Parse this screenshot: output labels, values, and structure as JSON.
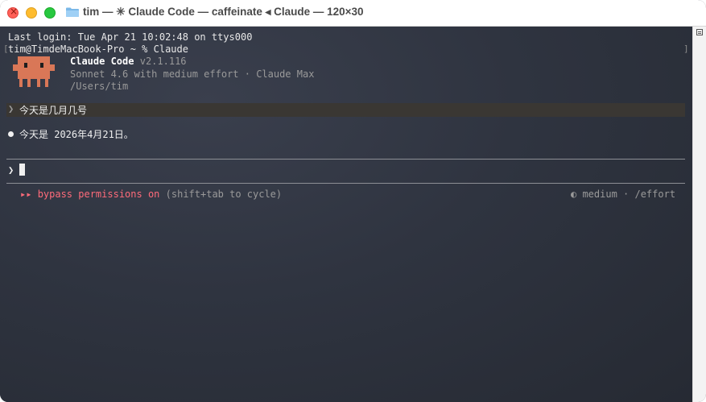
{
  "window": {
    "title": "tim — ✳ Claude Code — caffeinate ◂ Claude — 120×30"
  },
  "terminal": {
    "last_login": "Last login: Tue Apr 21 10:02:48 on ttys000",
    "shell_prompt": "tim@TimdeMacBook-Pro ~ % Claude",
    "bracket_left": "[",
    "bracket_right": "]",
    "banner": {
      "name": "Claude Code",
      "version": "v2.1.116",
      "model": "Sonnet 4.6 with medium effort · Claude Max",
      "path": "/Users/tim"
    },
    "user_message": {
      "chevron": "❯",
      "text": "今天是几月几号"
    },
    "assistant_reply": "今天是 2026年4月21日。",
    "input": {
      "chevron": "❯",
      "value": ""
    },
    "status": {
      "mode_icon": "▸▸",
      "mode": "bypass permissions on",
      "hint": "(shift+tab to cycle)",
      "effort": "◐ medium · /effort"
    }
  },
  "colors": {
    "accent_mascot": "#d97757",
    "mode_red": "#ff6b7a"
  },
  "icons": {
    "title_icon": "folder-icon",
    "mascot": "claude-mascot-icon"
  }
}
